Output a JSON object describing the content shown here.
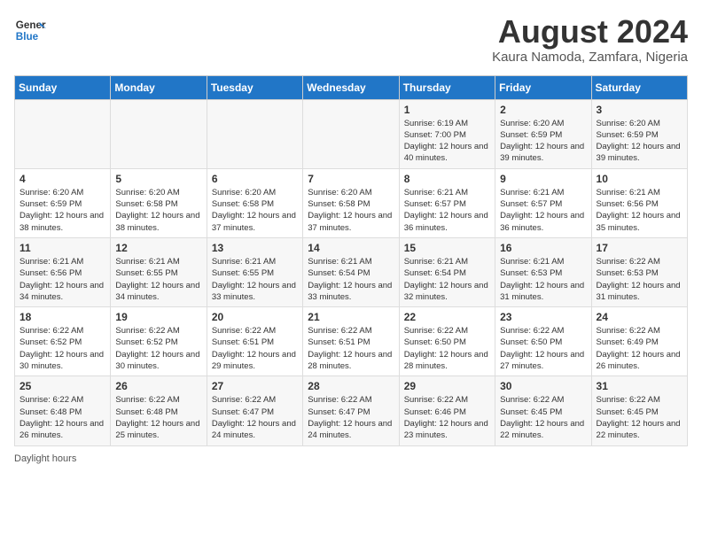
{
  "header": {
    "logo_line1": "General",
    "logo_line2": "Blue",
    "main_title": "August 2024",
    "subtitle": "Kaura Namoda, Zamfara, Nigeria"
  },
  "footer": {
    "daylight_label": "Daylight hours"
  },
  "days_of_week": [
    "Sunday",
    "Monday",
    "Tuesday",
    "Wednesday",
    "Thursday",
    "Friday",
    "Saturday"
  ],
  "weeks": [
    [
      {
        "day": "",
        "info": ""
      },
      {
        "day": "",
        "info": ""
      },
      {
        "day": "",
        "info": ""
      },
      {
        "day": "",
        "info": ""
      },
      {
        "day": "1",
        "info": "Sunrise: 6:19 AM\nSunset: 7:00 PM\nDaylight: 12 hours and 40 minutes."
      },
      {
        "day": "2",
        "info": "Sunrise: 6:20 AM\nSunset: 6:59 PM\nDaylight: 12 hours and 39 minutes."
      },
      {
        "day": "3",
        "info": "Sunrise: 6:20 AM\nSunset: 6:59 PM\nDaylight: 12 hours and 39 minutes."
      }
    ],
    [
      {
        "day": "4",
        "info": "Sunrise: 6:20 AM\nSunset: 6:59 PM\nDaylight: 12 hours and 38 minutes."
      },
      {
        "day": "5",
        "info": "Sunrise: 6:20 AM\nSunset: 6:58 PM\nDaylight: 12 hours and 38 minutes."
      },
      {
        "day": "6",
        "info": "Sunrise: 6:20 AM\nSunset: 6:58 PM\nDaylight: 12 hours and 37 minutes."
      },
      {
        "day": "7",
        "info": "Sunrise: 6:20 AM\nSunset: 6:58 PM\nDaylight: 12 hours and 37 minutes."
      },
      {
        "day": "8",
        "info": "Sunrise: 6:21 AM\nSunset: 6:57 PM\nDaylight: 12 hours and 36 minutes."
      },
      {
        "day": "9",
        "info": "Sunrise: 6:21 AM\nSunset: 6:57 PM\nDaylight: 12 hours and 36 minutes."
      },
      {
        "day": "10",
        "info": "Sunrise: 6:21 AM\nSunset: 6:56 PM\nDaylight: 12 hours and 35 minutes."
      }
    ],
    [
      {
        "day": "11",
        "info": "Sunrise: 6:21 AM\nSunset: 6:56 PM\nDaylight: 12 hours and 34 minutes."
      },
      {
        "day": "12",
        "info": "Sunrise: 6:21 AM\nSunset: 6:55 PM\nDaylight: 12 hours and 34 minutes."
      },
      {
        "day": "13",
        "info": "Sunrise: 6:21 AM\nSunset: 6:55 PM\nDaylight: 12 hours and 33 minutes."
      },
      {
        "day": "14",
        "info": "Sunrise: 6:21 AM\nSunset: 6:54 PM\nDaylight: 12 hours and 33 minutes."
      },
      {
        "day": "15",
        "info": "Sunrise: 6:21 AM\nSunset: 6:54 PM\nDaylight: 12 hours and 32 minutes."
      },
      {
        "day": "16",
        "info": "Sunrise: 6:21 AM\nSunset: 6:53 PM\nDaylight: 12 hours and 31 minutes."
      },
      {
        "day": "17",
        "info": "Sunrise: 6:22 AM\nSunset: 6:53 PM\nDaylight: 12 hours and 31 minutes."
      }
    ],
    [
      {
        "day": "18",
        "info": "Sunrise: 6:22 AM\nSunset: 6:52 PM\nDaylight: 12 hours and 30 minutes."
      },
      {
        "day": "19",
        "info": "Sunrise: 6:22 AM\nSunset: 6:52 PM\nDaylight: 12 hours and 30 minutes."
      },
      {
        "day": "20",
        "info": "Sunrise: 6:22 AM\nSunset: 6:51 PM\nDaylight: 12 hours and 29 minutes."
      },
      {
        "day": "21",
        "info": "Sunrise: 6:22 AM\nSunset: 6:51 PM\nDaylight: 12 hours and 28 minutes."
      },
      {
        "day": "22",
        "info": "Sunrise: 6:22 AM\nSunset: 6:50 PM\nDaylight: 12 hours and 28 minutes."
      },
      {
        "day": "23",
        "info": "Sunrise: 6:22 AM\nSunset: 6:50 PM\nDaylight: 12 hours and 27 minutes."
      },
      {
        "day": "24",
        "info": "Sunrise: 6:22 AM\nSunset: 6:49 PM\nDaylight: 12 hours and 26 minutes."
      }
    ],
    [
      {
        "day": "25",
        "info": "Sunrise: 6:22 AM\nSunset: 6:48 PM\nDaylight: 12 hours and 26 minutes."
      },
      {
        "day": "26",
        "info": "Sunrise: 6:22 AM\nSunset: 6:48 PM\nDaylight: 12 hours and 25 minutes."
      },
      {
        "day": "27",
        "info": "Sunrise: 6:22 AM\nSunset: 6:47 PM\nDaylight: 12 hours and 24 minutes."
      },
      {
        "day": "28",
        "info": "Sunrise: 6:22 AM\nSunset: 6:47 PM\nDaylight: 12 hours and 24 minutes."
      },
      {
        "day": "29",
        "info": "Sunrise: 6:22 AM\nSunset: 6:46 PM\nDaylight: 12 hours and 23 minutes."
      },
      {
        "day": "30",
        "info": "Sunrise: 6:22 AM\nSunset: 6:45 PM\nDaylight: 12 hours and 22 minutes."
      },
      {
        "day": "31",
        "info": "Sunrise: 6:22 AM\nSunset: 6:45 PM\nDaylight: 12 hours and 22 minutes."
      }
    ]
  ]
}
